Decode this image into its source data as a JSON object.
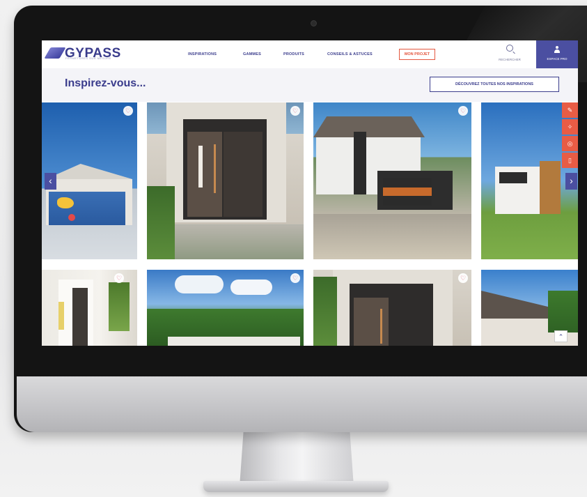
{
  "header": {
    "logo_text": "GYPASS",
    "logo_tagline": "FERMETURES SUR MESURE",
    "nav_items": [
      "INSPIRATIONS",
      "GAMMES",
      "PRODUITS",
      "CONSEILS & ASTUCES"
    ],
    "project_label": "MON PROJET",
    "search_label": "RECHERCHER",
    "pro_label": "ESPACE PRO"
  },
  "subheader": {
    "title": "Inspirez-vous...",
    "cta_label": "DÉCOUVREZ TOUTES NOS INSPIRATIONS"
  },
  "gallery": {
    "favorite_icon": "heart-icon",
    "prev_icon": "chevron-left-icon",
    "next_icon": "chevron-right-icon",
    "tools": [
      "paint-icon",
      "tools-icon",
      "target-icon",
      "phone-icon"
    ],
    "scroll_top_icon": "chevron-up-icon"
  },
  "colors": {
    "brand": "#3a3c8c",
    "accent": "#e85c45",
    "pro_bg": "#4b4fa1"
  }
}
